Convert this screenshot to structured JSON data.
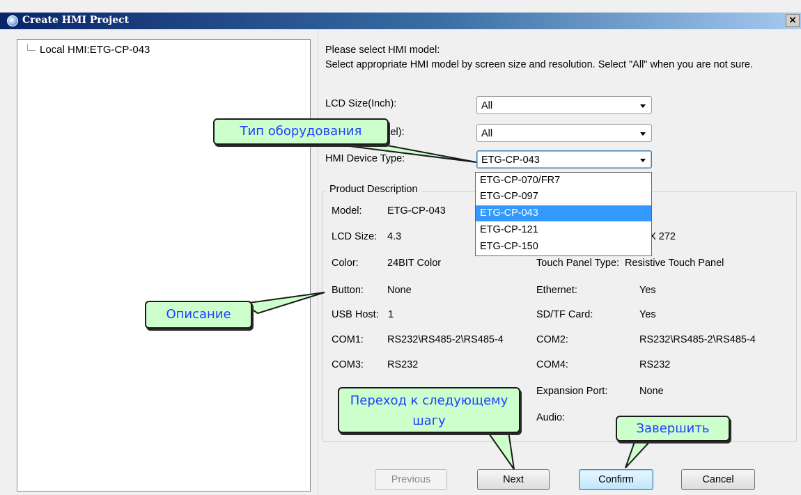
{
  "window": {
    "title": "Create HMI Project",
    "close_label": "×"
  },
  "tree": {
    "root_label": "Local HMI:ETG-CP-043"
  },
  "intro": {
    "line1": "Please select HMI model:",
    "line2": "Select appropriate HMI model by screen size and resolution. Select \"All\" when you are not sure."
  },
  "form": {
    "lcd_size_label": "LCD Size(Inch):",
    "lcd_size_value": "All",
    "resolution_label": "Resolution(Pixel):",
    "resolution_value": "All",
    "device_type_label": "HMI Device Type:",
    "device_type_value": "ETG-CP-043"
  },
  "dropdown": {
    "options": [
      "ETG-CP-070/FR7",
      "ETG-CP-097",
      "ETG-CP-043",
      "ETG-CP-121",
      "ETG-CP-150"
    ],
    "selected": "ETG-CP-043"
  },
  "description": {
    "legend": "Product Description",
    "model_label": "Model:",
    "model_value": "ETG-CP-043",
    "lcd_label": "LCD Size:",
    "lcd_value": "4.3",
    "resolution_value_partial": "0 X 272",
    "color_label": "Color:",
    "color_value": "24BIT Color",
    "touch_label": "Touch Panel Type:",
    "touch_value": "Resistive Touch Panel",
    "button_label": "Button:",
    "button_value": "None",
    "ethernet_label": "Ethernet:",
    "ethernet_value": "Yes",
    "usb_label": "USB Host:",
    "usb_value": "1",
    "sd_label": "SD/TF Card:",
    "sd_value": "Yes",
    "com1_label": "COM1:",
    "com1_value": "RS232\\RS485-2\\RS485-4",
    "com2_label": "COM2:",
    "com2_value": "RS232\\RS485-2\\RS485-4",
    "com3_label": "COM3:",
    "com3_value": "RS232",
    "com4_label": "COM4:",
    "com4_value": "RS232",
    "expansion_label": "Expansion Port:",
    "expansion_value": "None",
    "audio_label": "Audio:"
  },
  "buttons": {
    "previous": "Previous",
    "next": "Next",
    "confirm": "Confirm",
    "cancel": "Cancel"
  },
  "callouts": {
    "device_type": "Тип оборудования",
    "description": "Описание",
    "next_step": "Переход к следующему шагу",
    "finish": "Завершить"
  }
}
